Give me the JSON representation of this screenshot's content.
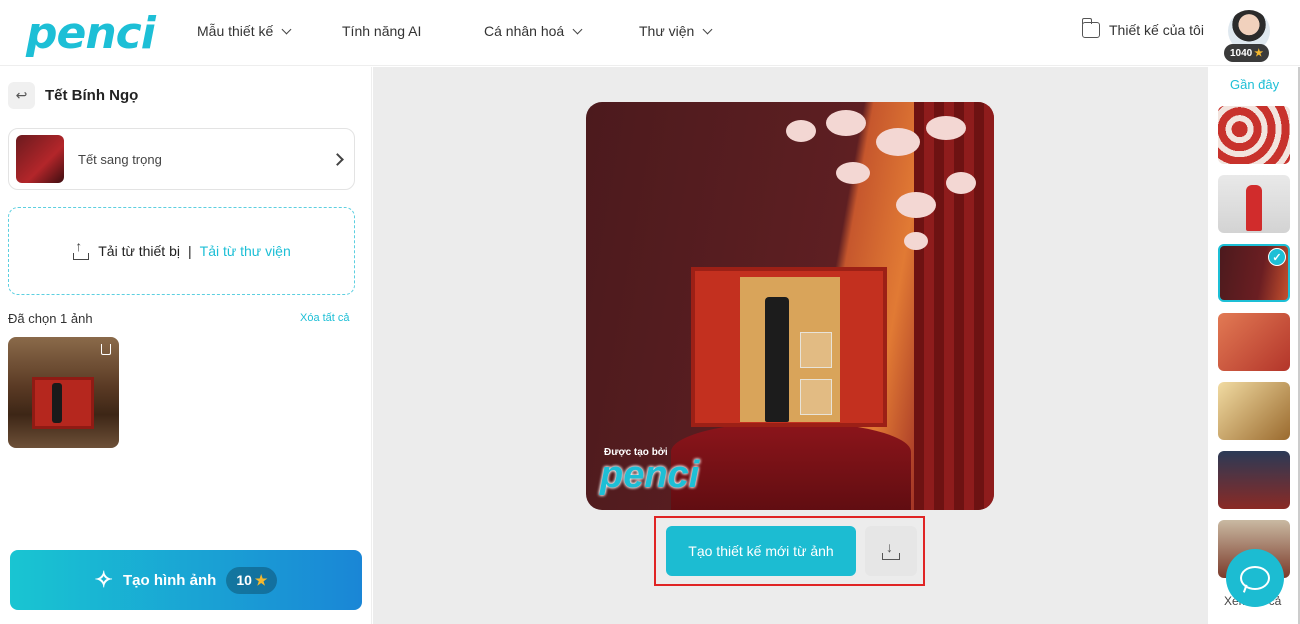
{
  "brand": {
    "logo_text": "penci",
    "accent": "#1dbfd6"
  },
  "nav": {
    "templates": "Mẫu thiết kế",
    "ai": "Tính năng AI",
    "personalize": "Cá nhân hoá",
    "library": "Thư viện"
  },
  "header": {
    "my_designs": "Thiết kế của tôi",
    "coins": "1040"
  },
  "left": {
    "title": "Tết Bính Ngọ",
    "style_name": "Tết sang trọng",
    "upload_device": "Tải từ thiết bị",
    "upload_sep": "|",
    "upload_library": "Tải từ thư viện",
    "selected_label": "Đã chọn 1 ảnh",
    "clear_all": "Xóa tất cả",
    "generate_label": "Tạo hình ảnh",
    "generate_cost": "10"
  },
  "canvas": {
    "watermark_small": "Được tạo bởi",
    "watermark": "penci",
    "new_design_button": "Tạo thiết kế mới từ ảnh"
  },
  "right": {
    "recent_label": "Gần đây",
    "see_all": "Xem tất cả"
  }
}
